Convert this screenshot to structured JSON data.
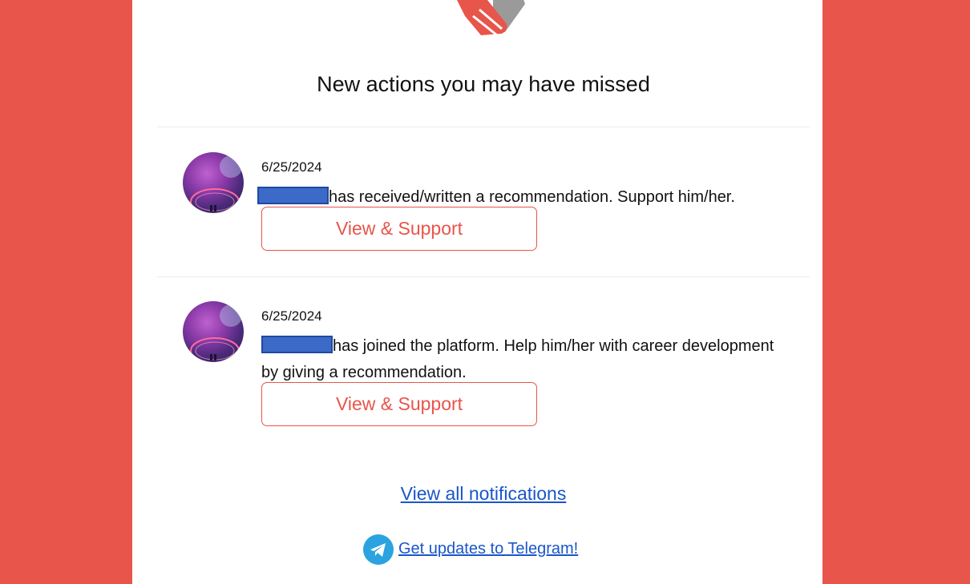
{
  "header": {
    "logo_icon": "handshake-icon",
    "title": "New actions you may have missed"
  },
  "notifications": [
    {
      "date": "6/25/2024",
      "message": "has received/written a recommendation. Support him/her.",
      "button_label": "View & Support"
    },
    {
      "date": "6/25/2024",
      "message": "has joined the platform. Help him/her with career development by giving a recommendation.",
      "button_label": "View & Support"
    }
  ],
  "footer": {
    "view_all_label": "View all notifications",
    "telegram_icon": "telegram-icon",
    "telegram_label": "Get updates to Telegram!"
  },
  "colors": {
    "brand_red": "#e8554a",
    "link_blue": "#1a56c9",
    "telegram_blue": "#2aa3e0",
    "redaction_blue": "#3c6ac8"
  }
}
